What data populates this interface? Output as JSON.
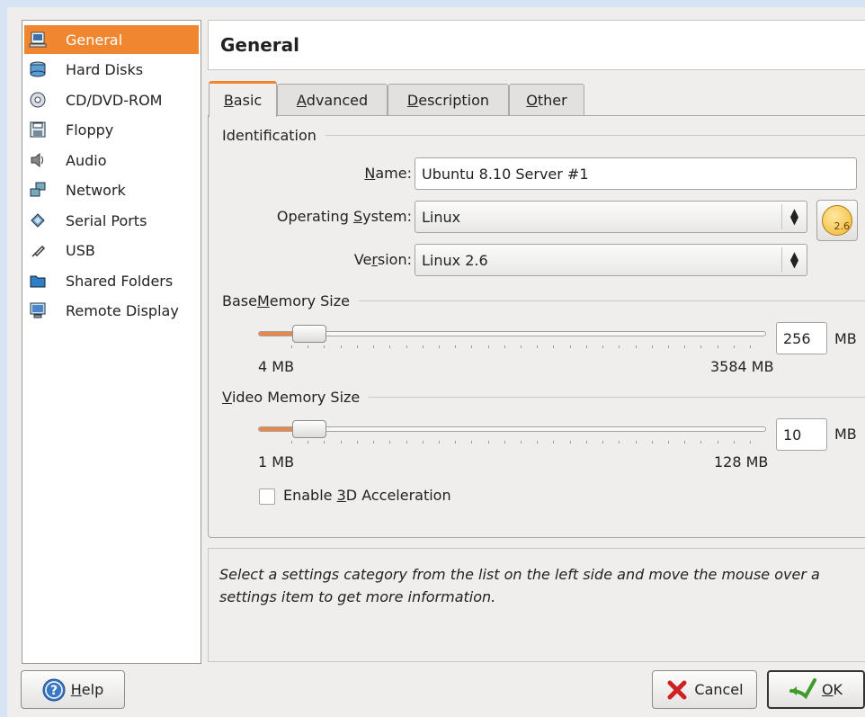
{
  "sidebar": {
    "items": [
      {
        "label": "General",
        "icon": "general-icon",
        "active": true
      },
      {
        "label": "Hard Disks",
        "icon": "hard-disk-icon"
      },
      {
        "label": "CD/DVD-ROM",
        "icon": "cd-icon"
      },
      {
        "label": "Floppy",
        "icon": "floppy-icon"
      },
      {
        "label": "Audio",
        "icon": "audio-icon"
      },
      {
        "label": "Network",
        "icon": "network-icon"
      },
      {
        "label": "Serial Ports",
        "icon": "serial-ports-icon"
      },
      {
        "label": "USB",
        "icon": "usb-icon"
      },
      {
        "label": "Shared Folders",
        "icon": "folder-icon"
      },
      {
        "label": "Remote Display",
        "icon": "remote-display-icon"
      }
    ]
  },
  "header": {
    "title": "General"
  },
  "tabs": [
    {
      "label_u": "B",
      "label_rest": "asic",
      "active": true
    },
    {
      "label_u": "A",
      "label_rest": "dvanced"
    },
    {
      "label_u": "D",
      "label_rest": "escription"
    },
    {
      "label_u": "O",
      "label_rest": "ther"
    }
  ],
  "identification": {
    "title": "Identification",
    "name_label_u": "N",
    "name_label_rest": "ame:",
    "name_value": "Ubuntu 8.10 Server #1",
    "os_label_pre": "Operating ",
    "os_label_u": "S",
    "os_label_rest": "ystem:",
    "os_value": "Linux",
    "version_label_pre": "Ve",
    "version_label_u": "r",
    "version_label_rest": "sion:",
    "version_value": "Linux 2.6",
    "os_badge": "2.6"
  },
  "base_memory": {
    "title_pre": "Base ",
    "title_u": "M",
    "title_rest": "emory Size",
    "min_label": "4 MB",
    "max_label": "3584 MB",
    "value": "256",
    "unit": "MB",
    "fraction": 0.07
  },
  "video_memory": {
    "title_u": "V",
    "title_rest": "ideo Memory Size",
    "min_label": "1 MB",
    "max_label": "128 MB",
    "value": "10",
    "unit": "MB",
    "fraction": 0.07
  },
  "acceleration": {
    "label_pre": "Enable ",
    "label_u": "3",
    "label_rest": "D Acceleration",
    "checked": false
  },
  "info_text": "Select a settings category from the list on the left side and move the mouse over a settings item to get more information.",
  "buttons": {
    "help_u": "H",
    "help_rest": "elp",
    "cancel": "Cancel",
    "ok_u": "O",
    "ok_rest": "K"
  },
  "colors": {
    "accent": "#f0862f",
    "slider_fill": "#e8874a"
  }
}
